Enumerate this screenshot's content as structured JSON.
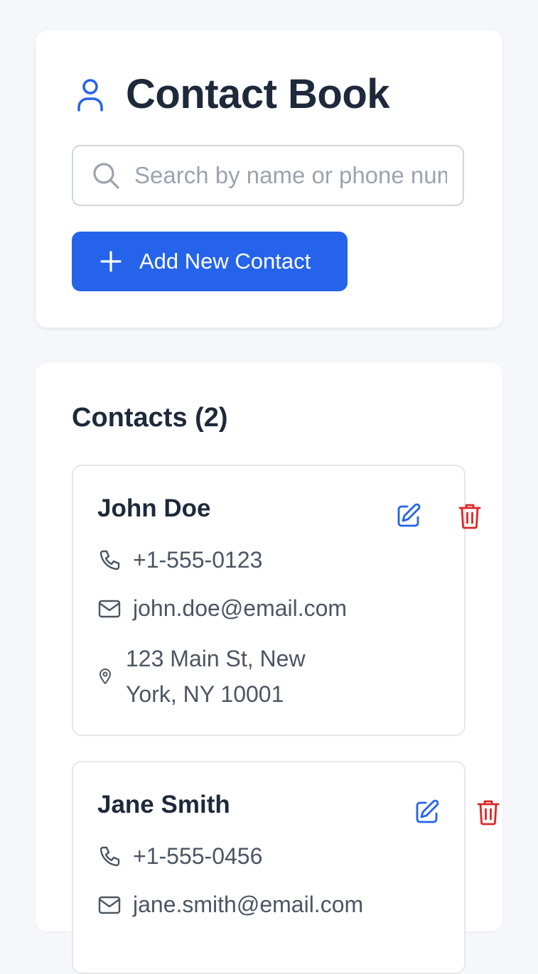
{
  "header": {
    "title": "Contact Book",
    "title_icon": "user-icon"
  },
  "search": {
    "placeholder": "Search by name or phone number...",
    "value": ""
  },
  "add_button": {
    "label": "Add New Contact",
    "icon": "plus-icon"
  },
  "contacts_section": {
    "title": "Contacts (2)"
  },
  "contacts": [
    {
      "name": "John Doe",
      "phone": "+1-555-0123",
      "email": "john.doe@email.com",
      "address": "123 Main St, New York, NY 10001"
    },
    {
      "name": "Jane Smith",
      "phone": "+1-555-0456",
      "email": "jane.smith@email.com"
    }
  ],
  "colors": {
    "accent": "#2563eb",
    "delete": "#dc2626",
    "title": "#1e293b",
    "muted": "#4b5563",
    "background": "#f5f7fa"
  }
}
